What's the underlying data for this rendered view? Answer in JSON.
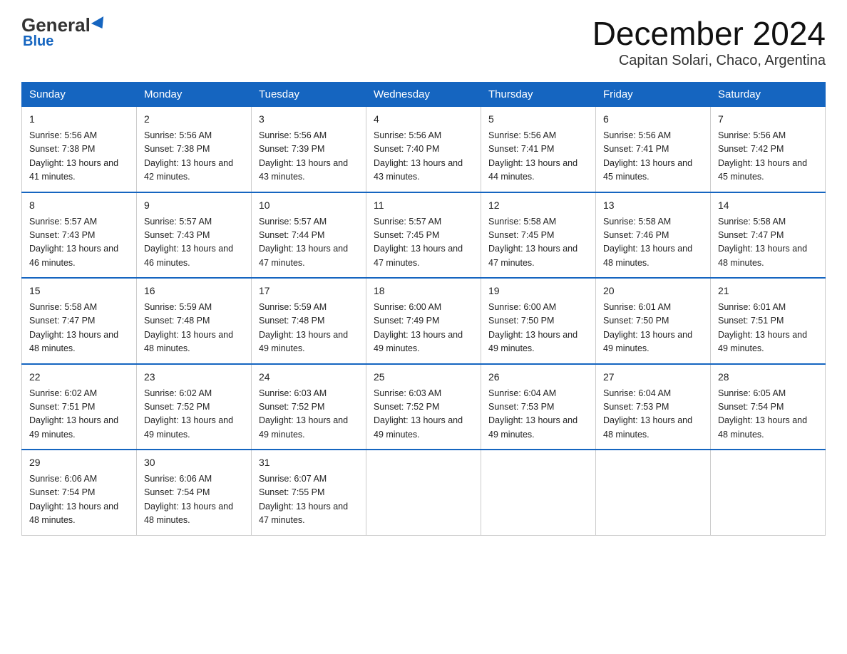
{
  "header": {
    "title": "December 2024",
    "location": "Capitan Solari, Chaco, Argentina",
    "logo_general": "General",
    "logo_blue": "Blue"
  },
  "columns": [
    "Sunday",
    "Monday",
    "Tuesday",
    "Wednesday",
    "Thursday",
    "Friday",
    "Saturday"
  ],
  "weeks": [
    [
      {
        "day": "1",
        "rise": "5:56 AM",
        "set": "7:38 PM",
        "daylight": "13 hours and 41 minutes."
      },
      {
        "day": "2",
        "rise": "5:56 AM",
        "set": "7:38 PM",
        "daylight": "13 hours and 42 minutes."
      },
      {
        "day": "3",
        "rise": "5:56 AM",
        "set": "7:39 PM",
        "daylight": "13 hours and 43 minutes."
      },
      {
        "day": "4",
        "rise": "5:56 AM",
        "set": "7:40 PM",
        "daylight": "13 hours and 43 minutes."
      },
      {
        "day": "5",
        "rise": "5:56 AM",
        "set": "7:41 PM",
        "daylight": "13 hours and 44 minutes."
      },
      {
        "day": "6",
        "rise": "5:56 AM",
        "set": "7:41 PM",
        "daylight": "13 hours and 45 minutes."
      },
      {
        "day": "7",
        "rise": "5:56 AM",
        "set": "7:42 PM",
        "daylight": "13 hours and 45 minutes."
      }
    ],
    [
      {
        "day": "8",
        "rise": "5:57 AM",
        "set": "7:43 PM",
        "daylight": "13 hours and 46 minutes."
      },
      {
        "day": "9",
        "rise": "5:57 AM",
        "set": "7:43 PM",
        "daylight": "13 hours and 46 minutes."
      },
      {
        "day": "10",
        "rise": "5:57 AM",
        "set": "7:44 PM",
        "daylight": "13 hours and 47 minutes."
      },
      {
        "day": "11",
        "rise": "5:57 AM",
        "set": "7:45 PM",
        "daylight": "13 hours and 47 minutes."
      },
      {
        "day": "12",
        "rise": "5:58 AM",
        "set": "7:45 PM",
        "daylight": "13 hours and 47 minutes."
      },
      {
        "day": "13",
        "rise": "5:58 AM",
        "set": "7:46 PM",
        "daylight": "13 hours and 48 minutes."
      },
      {
        "day": "14",
        "rise": "5:58 AM",
        "set": "7:47 PM",
        "daylight": "13 hours and 48 minutes."
      }
    ],
    [
      {
        "day": "15",
        "rise": "5:58 AM",
        "set": "7:47 PM",
        "daylight": "13 hours and 48 minutes."
      },
      {
        "day": "16",
        "rise": "5:59 AM",
        "set": "7:48 PM",
        "daylight": "13 hours and 48 minutes."
      },
      {
        "day": "17",
        "rise": "5:59 AM",
        "set": "7:48 PM",
        "daylight": "13 hours and 49 minutes."
      },
      {
        "day": "18",
        "rise": "6:00 AM",
        "set": "7:49 PM",
        "daylight": "13 hours and 49 minutes."
      },
      {
        "day": "19",
        "rise": "6:00 AM",
        "set": "7:50 PM",
        "daylight": "13 hours and 49 minutes."
      },
      {
        "day": "20",
        "rise": "6:01 AM",
        "set": "7:50 PM",
        "daylight": "13 hours and 49 minutes."
      },
      {
        "day": "21",
        "rise": "6:01 AM",
        "set": "7:51 PM",
        "daylight": "13 hours and 49 minutes."
      }
    ],
    [
      {
        "day": "22",
        "rise": "6:02 AM",
        "set": "7:51 PM",
        "daylight": "13 hours and 49 minutes."
      },
      {
        "day": "23",
        "rise": "6:02 AM",
        "set": "7:52 PM",
        "daylight": "13 hours and 49 minutes."
      },
      {
        "day": "24",
        "rise": "6:03 AM",
        "set": "7:52 PM",
        "daylight": "13 hours and 49 minutes."
      },
      {
        "day": "25",
        "rise": "6:03 AM",
        "set": "7:52 PM",
        "daylight": "13 hours and 49 minutes."
      },
      {
        "day": "26",
        "rise": "6:04 AM",
        "set": "7:53 PM",
        "daylight": "13 hours and 49 minutes."
      },
      {
        "day": "27",
        "rise": "6:04 AM",
        "set": "7:53 PM",
        "daylight": "13 hours and 48 minutes."
      },
      {
        "day": "28",
        "rise": "6:05 AM",
        "set": "7:54 PM",
        "daylight": "13 hours and 48 minutes."
      }
    ],
    [
      {
        "day": "29",
        "rise": "6:06 AM",
        "set": "7:54 PM",
        "daylight": "13 hours and 48 minutes."
      },
      {
        "day": "30",
        "rise": "6:06 AM",
        "set": "7:54 PM",
        "daylight": "13 hours and 48 minutes."
      },
      {
        "day": "31",
        "rise": "6:07 AM",
        "set": "7:55 PM",
        "daylight": "13 hours and 47 minutes."
      },
      null,
      null,
      null,
      null
    ]
  ]
}
